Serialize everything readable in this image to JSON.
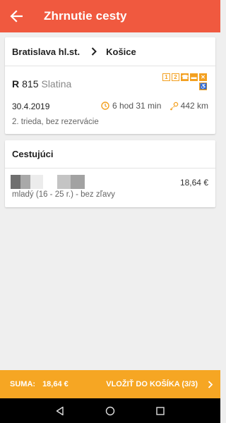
{
  "header": {
    "title": "Zhrnutie cesty",
    "background": "#f0593f"
  },
  "route": {
    "from": "Bratislava hl.st.",
    "to": "Košice"
  },
  "train": {
    "category": "R",
    "number": "815",
    "name": "Slatina",
    "amenities": [
      "1",
      "2",
      "phone-icon",
      "bed-icon",
      "restaurant-icon",
      "wheelchair-icon"
    ],
    "date": "30.4.2019",
    "duration": "6 hod 31 min",
    "distance": "442 km",
    "class_info": "2. trieda, bez rezervácie"
  },
  "passengers": {
    "title": "Cestujúci",
    "items": [
      {
        "name_redacted": true,
        "price": "18,64 €",
        "type": "mladý (16 - 25 r.) - bez zľavy"
      }
    ]
  },
  "footer": {
    "sum_label": "SUMA:",
    "sum_value": "18,64 €",
    "cart_label": "VLOŽIŤ DO KOŠÍKA (3/3)",
    "background": "#f6a623"
  },
  "accent": "#f3a020"
}
